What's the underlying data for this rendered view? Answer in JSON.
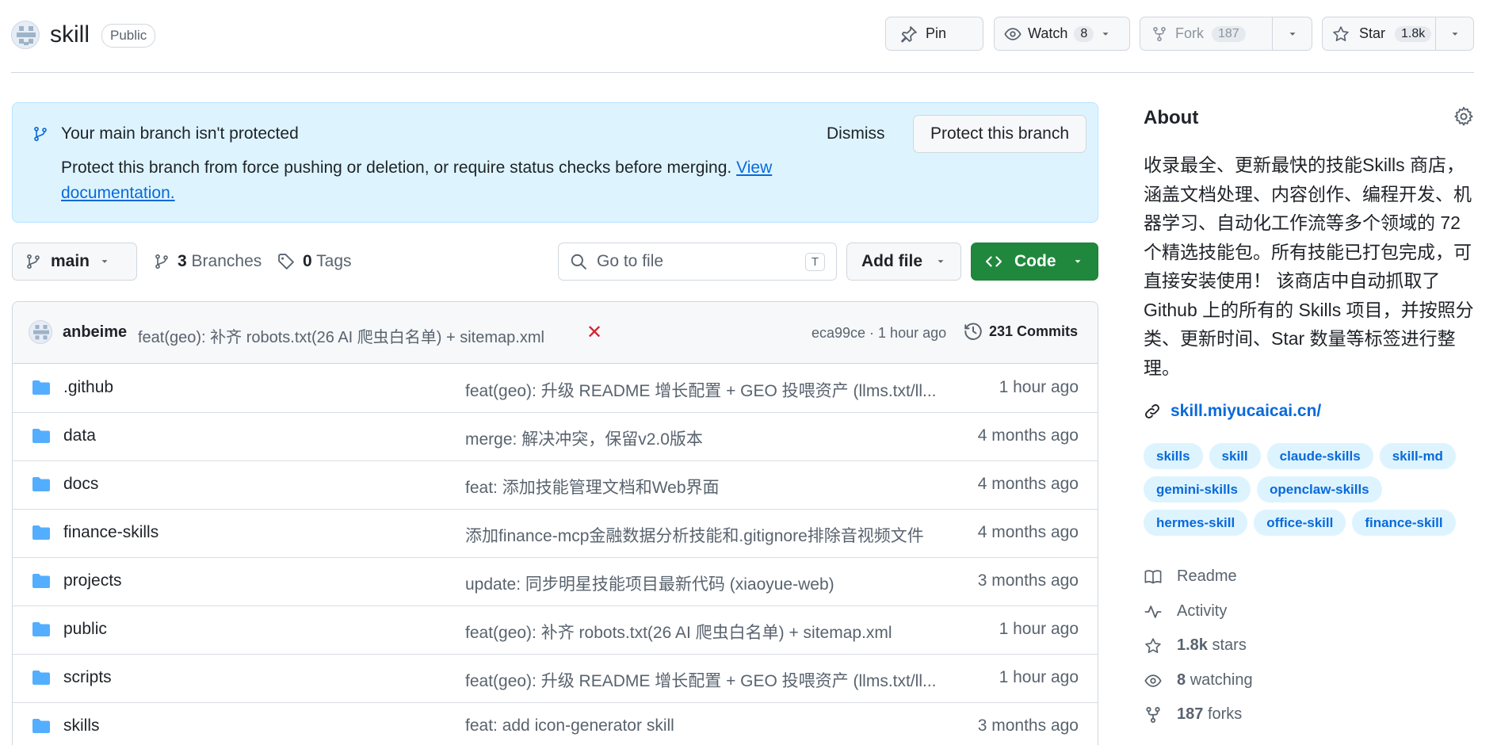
{
  "repo": {
    "name": "skill",
    "visibility": "Public"
  },
  "header_buttons": {
    "pin_label": "Pin",
    "watch_label": "Watch",
    "watch_count": "8",
    "fork_label": "Fork",
    "fork_count": "187",
    "star_label": "Star",
    "star_count": "1.8k"
  },
  "banner": {
    "title": "Your main branch isn't protected",
    "description": "Protect this branch from force pushing or deletion, or require status checks before merging.",
    "link_text": "View documentation.",
    "dismiss_label": "Dismiss",
    "protect_label": "Protect this branch"
  },
  "toolbar": {
    "branch": "main",
    "branches_count": "3",
    "branches_label": "Branches",
    "tags_count": "0",
    "tags_label": "Tags",
    "goto_placeholder": "Go to file",
    "goto_shortcut": "T",
    "add_file_label": "Add file",
    "code_label": "Code"
  },
  "latest_commit": {
    "author": "anbeime",
    "message": "feat(geo): 补齐 robots.txt(26 AI 爬虫白名单) + sitemap.xml",
    "status": "✕",
    "hash_time": "eca99ce · 1 hour ago",
    "commits_label": "231 Commits"
  },
  "files": [
    {
      "name": ".github",
      "message": "feat(geo): 升级 README 增长配置 + GEO 投喂资产 (llms.txt/ll...",
      "time": "1 hour ago"
    },
    {
      "name": "data",
      "message": "merge: 解决冲突，保留v2.0版本",
      "time": "4 months ago"
    },
    {
      "name": "docs",
      "message": "feat: 添加技能管理文档和Web界面",
      "time": "4 months ago"
    },
    {
      "name": "finance-skills",
      "message": "添加finance-mcp金融数据分析技能和.gitignore排除音视频文件",
      "time": "4 months ago"
    },
    {
      "name": "projects",
      "message": "update: 同步明星技能项目最新代码 (xiaoyue-web)",
      "time": "3 months ago"
    },
    {
      "name": "public",
      "message": "feat(geo): 补齐 robots.txt(26 AI 爬虫白名单) + sitemap.xml",
      "time": "1 hour ago"
    },
    {
      "name": "scripts",
      "message": "feat(geo): 升级 README 增长配置 + GEO 投喂资产 (llms.txt/ll...",
      "time": "1 hour ago"
    },
    {
      "name": "skills",
      "message": "feat: add icon-generator skill",
      "time": "3 months ago"
    }
  ],
  "about": {
    "title": "About",
    "description": "收录最全、更新最快的技能Skills 商店，涵盖文档处理、内容创作、编程开发、机器学习、自动化工作流等多个领域的 72 个精选技能包。所有技能已打包完成，可直接安装使用！ 该商店中自动抓取了 Github 上的所有的 Skills 项目，并按照分类、更新时间、Star 数量等标签进行整理。",
    "link": "skill.miyucaicai.cn/",
    "topics": [
      "skills",
      "skill",
      "claude-skills",
      "skill-md",
      "gemini-skills",
      "openclaw-skills",
      "hermes-skill",
      "office-skill",
      "finance-skill"
    ],
    "readme_label": "Readme",
    "activity_label": "Activity",
    "stars_value": "1.8k",
    "stars_label": "stars",
    "watching_value": "8",
    "watching_label": "watching",
    "forks_value": "187",
    "forks_label": "forks"
  },
  "colors": {
    "accent": "#0969da",
    "primary_button": "#1f883d",
    "banner_bg": "#ddf4ff",
    "folder": "#54aeff",
    "error": "#d1242f"
  }
}
